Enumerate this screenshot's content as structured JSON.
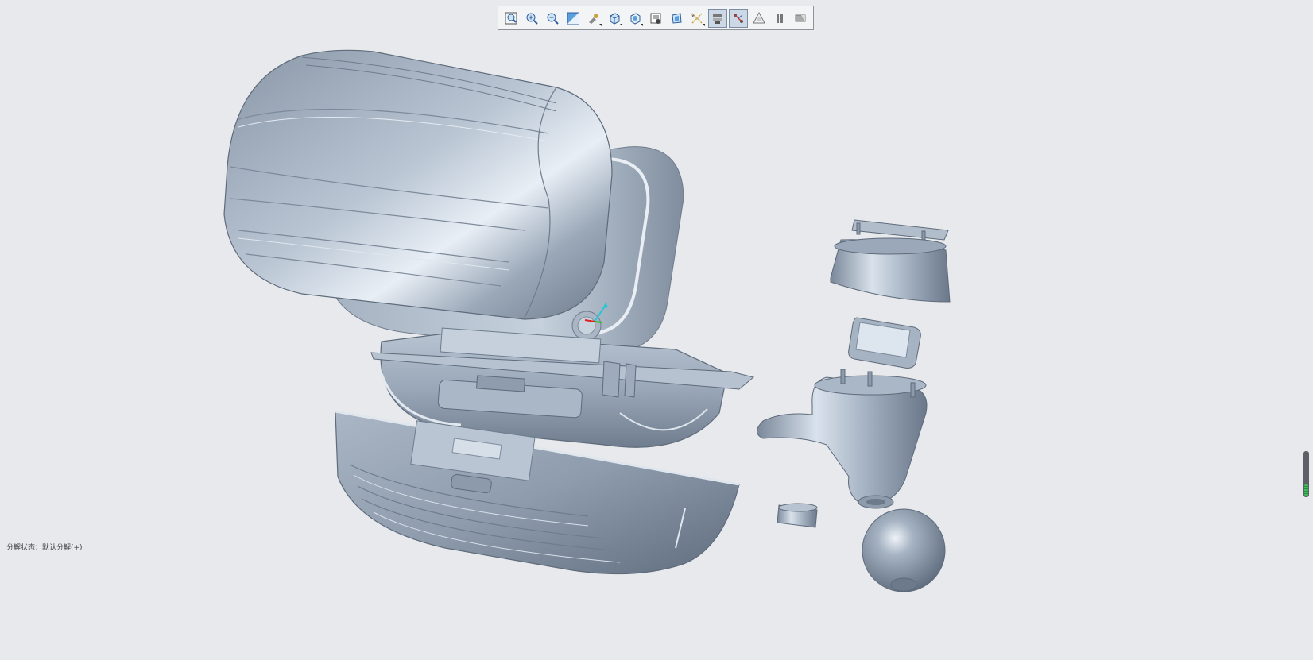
{
  "toolbar": {
    "buttons": [
      {
        "icon": "zoom-fit-icon",
        "active": false,
        "flyout": false
      },
      {
        "icon": "zoom-in-icon",
        "active": false,
        "flyout": false
      },
      {
        "icon": "zoom-out-icon",
        "active": false,
        "flyout": false
      },
      {
        "icon": "repaint-icon",
        "active": false,
        "flyout": false
      },
      {
        "icon": "view-manager-icon",
        "active": false,
        "flyout": true
      },
      {
        "icon": "display-style-icon",
        "active": false,
        "flyout": true
      },
      {
        "icon": "named-views-icon",
        "active": false,
        "flyout": true
      },
      {
        "icon": "view-manager-palette-icon",
        "active": false,
        "flyout": false
      },
      {
        "icon": "perspective-icon",
        "active": false,
        "flyout": false
      },
      {
        "icon": "datum-display-icon",
        "active": false,
        "flyout": true
      },
      {
        "icon": "toggle-explode-icon",
        "active": true,
        "flyout": false
      },
      {
        "icon": "toggle-offset-lines-icon",
        "active": true,
        "flyout": false
      },
      {
        "icon": "annotation-display-icon",
        "active": false,
        "flyout": false
      },
      {
        "icon": "pause-icon",
        "active": false,
        "flyout": false
      },
      {
        "icon": "spin-center-icon",
        "active": false,
        "flyout": false
      }
    ]
  },
  "status": {
    "explode_state": "分解状态：默认分解(+)"
  },
  "scroll_indicator": {
    "level": 0.25
  },
  "colors": {
    "background": "#e8e9ec",
    "model": "#a7b4c3",
    "model_dark": "#6e7c8d",
    "axis_x": "#e02020",
    "axis_y": "#20c020",
    "axis_z": "#20c8d8"
  }
}
